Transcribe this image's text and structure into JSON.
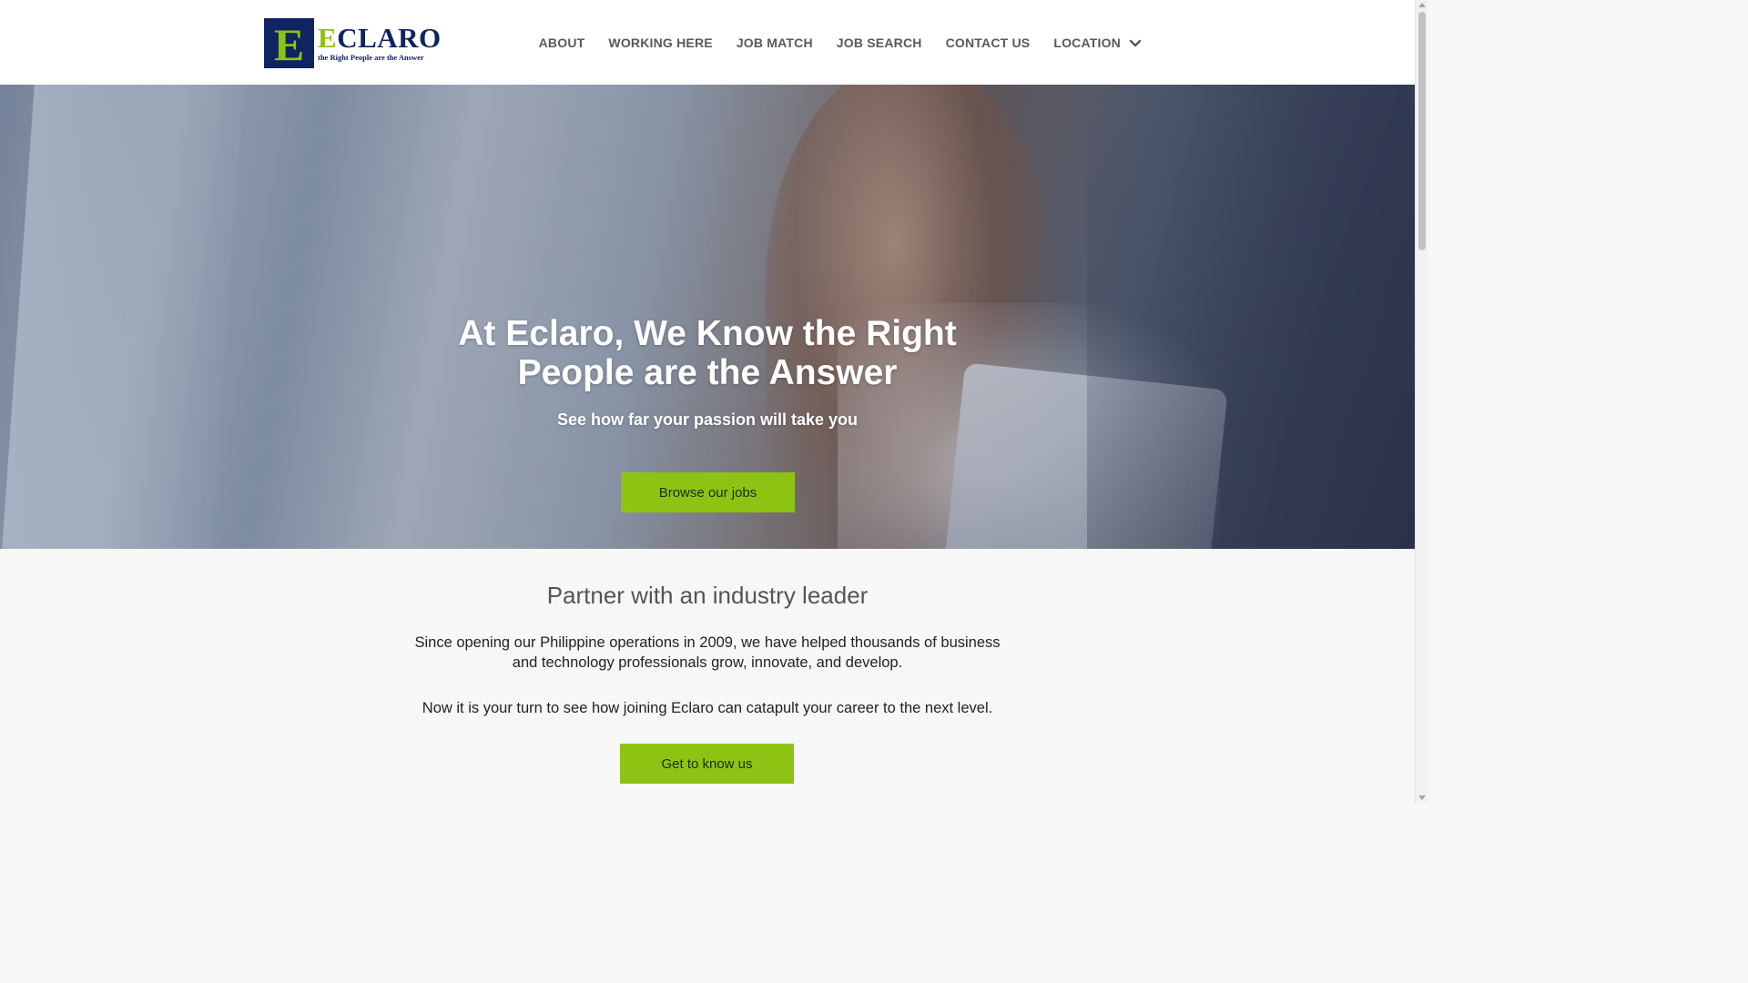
{
  "header": {
    "logo": {
      "letter": "E",
      "word_accent": "E",
      "word_rest": "CLARO",
      "tagline": "the Right People are the Answer"
    },
    "nav": [
      {
        "label": "ABOUT"
      },
      {
        "label": "WORKING HERE"
      },
      {
        "label": "JOB MATCH"
      },
      {
        "label": "JOB SEARCH"
      },
      {
        "label": "CONTACT US"
      },
      {
        "label": "LOCATION",
        "icon": "chevron-down-icon"
      }
    ]
  },
  "hero": {
    "title": "At Eclaro, We Know the Right People are the Answer",
    "subtitle": "See how far your passion will take you",
    "button_label": "Browse our jobs"
  },
  "partner": {
    "title": "Partner with an industry leader",
    "paragraph1": "Since opening our Philippine operations in 2009, we have helped thousands of business and technology professionals grow, innovate, and develop.",
    "paragraph2": "Now it is your turn to see how joining Eclaro can catapult your career to the next level.",
    "button_label": "Get to know us"
  },
  "colors": {
    "brand_navy": "#0f2461",
    "brand_green": "#8dc214",
    "button_green": "#8dc414"
  }
}
